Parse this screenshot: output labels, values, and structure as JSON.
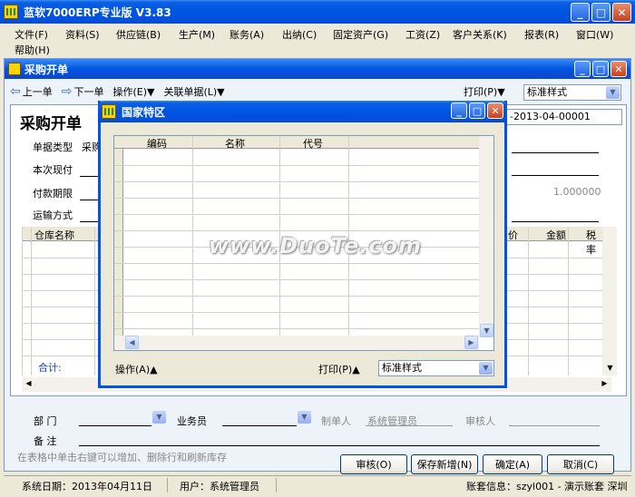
{
  "app": {
    "title": "蓝软7000ERP专业版   V3.83"
  },
  "menu": [
    "文件(F)",
    "资料(S)",
    "供应链(B)",
    "生产(M)",
    "账务(A)",
    "出纳(C)",
    "固定资产(G)",
    "工资(Z)",
    "客户关系(K)",
    "报表(R)",
    "窗口(W)",
    "帮助(H)"
  ],
  "doc_window": {
    "title": "采购开单",
    "toolbar": {
      "prev": "上一单",
      "next": "下一单",
      "operate": "操作(E)▼",
      "related": "关联单据(L)▼",
      "print": "打印(P)▼",
      "style": "标准样式"
    },
    "form_title": "采购开单",
    "fields": {
      "doc_type_label": "单据类型",
      "doc_type_value": "采购",
      "current_pay_label": "本次现付",
      "pay_term_label": "付款期限",
      "ship_label": "运输方式",
      "doc_no": "-2013-04-00001",
      "rate": "1.000000"
    },
    "grid": {
      "col_warehouse": "仓库名称",
      "col_price": "价",
      "col_amount": "金额",
      "col_tax": "税率",
      "total_label": "合计:"
    },
    "bottom": {
      "dept_label": "部  门",
      "sales_label": "业务员",
      "maker_label": "制单人",
      "maker_value": "系统管理员",
      "auditor_label": "审核人",
      "remark_label": "备  注",
      "hint": "在表格中单击右键可以增加、删除行和刷新库存"
    },
    "buttons": {
      "audit": "审核(O)",
      "save_new": "保存新增(N)",
      "ok": "确定(A)",
      "cancel": "取消(C)"
    }
  },
  "dialog": {
    "title": "国家特区",
    "columns": [
      "编码",
      "名称",
      "代号"
    ],
    "operate": "操作(A)▲",
    "print": "打印(P)▲",
    "style": "标准样式"
  },
  "watermark": "www.DuoTe.com",
  "status": {
    "system_date": "系统日期：2013年04月11日",
    "user": "用户：系统管理员",
    "account": "账套信息：szyl001 - 演示账套 深圳"
  }
}
